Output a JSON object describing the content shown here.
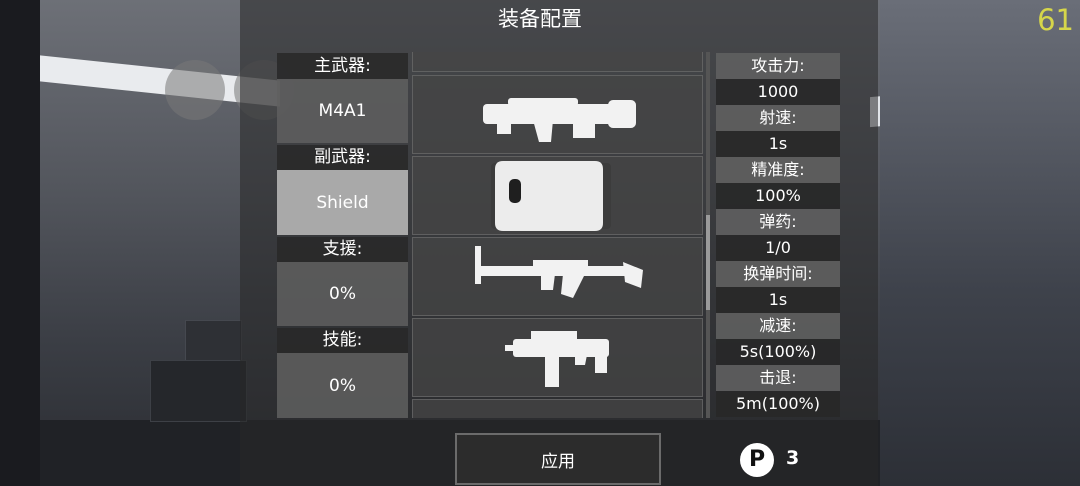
{
  "header": {
    "title": "装备配置",
    "fps": "61"
  },
  "categories": {
    "primary_label": "主武器:",
    "primary_value": "M4A1",
    "secondary_label": "副武器:",
    "secondary_value": "Shield",
    "support_label": "支援:",
    "support_value": "0%",
    "skill_label": "技能:",
    "skill_value": "0%"
  },
  "weapons": [
    {
      "icon": "launcher-icon"
    },
    {
      "icon": "shield-icon"
    },
    {
      "icon": "rifle-icon"
    },
    {
      "icon": "smg-icon"
    }
  ],
  "stats": {
    "attack_label": "攻击力:",
    "attack_value": "1000",
    "rate_label": "射速:",
    "rate_value": "1s",
    "accuracy_label": "精准度:",
    "accuracy_value": "100%",
    "ammo_label": "弹药:",
    "ammo_value": "1/0",
    "reload_label": "换弹时间:",
    "reload_value": "1s",
    "slow_label": "减速:",
    "slow_value": "5s(100%)",
    "knockback_label": "击退:",
    "knockback_value": "5m(100%)"
  },
  "footer": {
    "apply_label": "应用",
    "points_symbol": "P",
    "points_count": "3"
  }
}
